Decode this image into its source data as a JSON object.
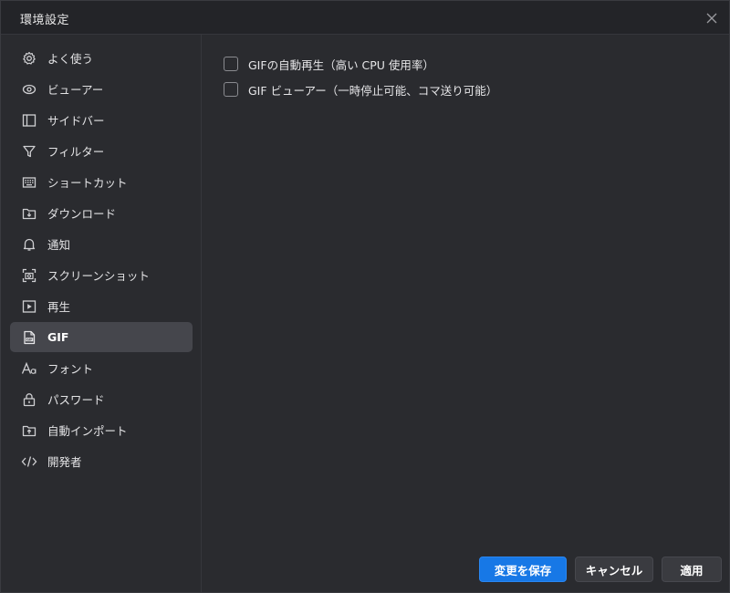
{
  "window": {
    "title": "環境設定"
  },
  "sidebar": {
    "items": [
      {
        "label": "よく使う",
        "icon": "gear-icon"
      },
      {
        "label": "ビューアー",
        "icon": "eye-icon"
      },
      {
        "label": "サイドバー",
        "icon": "sidebar-icon"
      },
      {
        "label": "フィルター",
        "icon": "filter-icon"
      },
      {
        "label": "ショートカット",
        "icon": "keyboard-icon"
      },
      {
        "label": "ダウンロード",
        "icon": "download-icon"
      },
      {
        "label": "通知",
        "icon": "bell-icon"
      },
      {
        "label": "スクリーンショット",
        "icon": "screenshot-icon"
      },
      {
        "label": "再生",
        "icon": "play-icon"
      },
      {
        "label": "GIF",
        "icon": "gif-file-icon",
        "active": true
      },
      {
        "label": "フォント",
        "icon": "font-icon"
      },
      {
        "label": "パスワード",
        "icon": "lock-icon"
      },
      {
        "label": "自動インポート",
        "icon": "import-icon"
      },
      {
        "label": "開発者",
        "icon": "code-icon"
      }
    ]
  },
  "content": {
    "options": [
      {
        "label": "GIFの自動再生（高い CPU 使用率）",
        "checked": false
      },
      {
        "label": "GIF ビューアー（一時停止可能、コマ送り可能）",
        "checked": false
      }
    ]
  },
  "footer": {
    "save_label": "変更を保存",
    "cancel_label": "キャンセル",
    "apply_label": "適用"
  },
  "colors": {
    "accent": "#1778e6",
    "background": "#2a2b2f",
    "active_item": "#45464c"
  }
}
